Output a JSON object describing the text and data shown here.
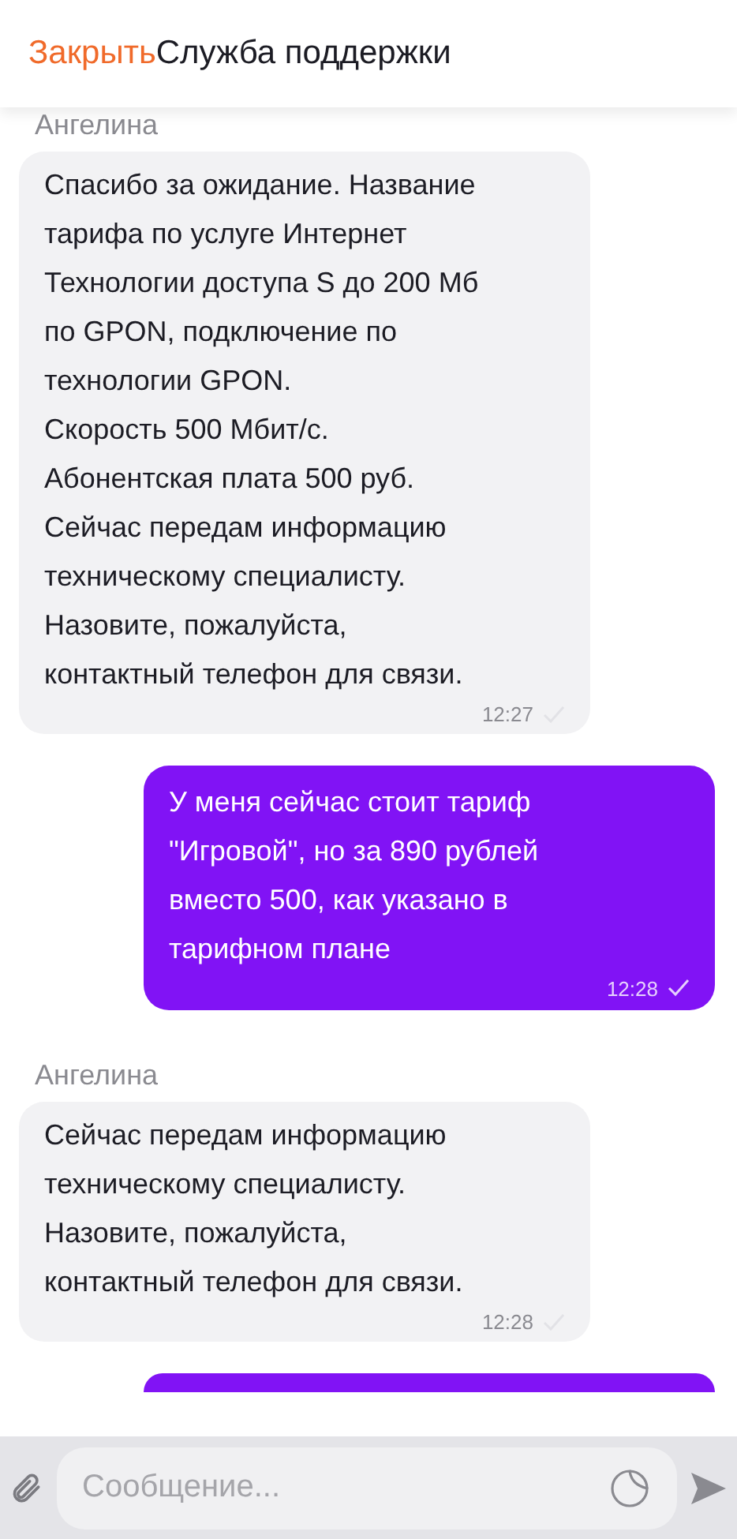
{
  "header": {
    "close": "Закрыть",
    "title": "Служба поддержки"
  },
  "messages": [
    {
      "kind": "incoming",
      "sender": "Ангелина",
      "lines": [
        "Спасибо за ожидание. Название",
        "тарифа по услуге Интернет",
        "Технологии доступа S до 200 Мб",
        "по GPON, подключение по",
        "технологии GPON.",
        "Скорость 500 Мбит/с.",
        "Абонентская плата 500 руб.",
        "Сейчас передам информацию",
        "техническому специалисту.",
        "Назовите, пожалуйста,",
        "контактный телефон для связи."
      ],
      "time": "12:27",
      "read": true
    },
    {
      "kind": "outgoing",
      "lines": [
        "У меня сейчас стоит тариф",
        "\"Игровой\", но за 890 рублей",
        "вместо 500, как указано в",
        "тарифном плане"
      ],
      "time": "12:28",
      "read": true
    },
    {
      "kind": "incoming",
      "sender": "Ангелина",
      "lines": [
        "Сейчас передам информацию",
        "техническому специалисту.",
        "Назовите, пожалуйста,",
        "контактный телефон для связи."
      ],
      "time": "12:28",
      "read": true
    },
    {
      "kind": "outgoing-cut"
    }
  ],
  "composer": {
    "placeholder": "Сообщение..."
  }
}
